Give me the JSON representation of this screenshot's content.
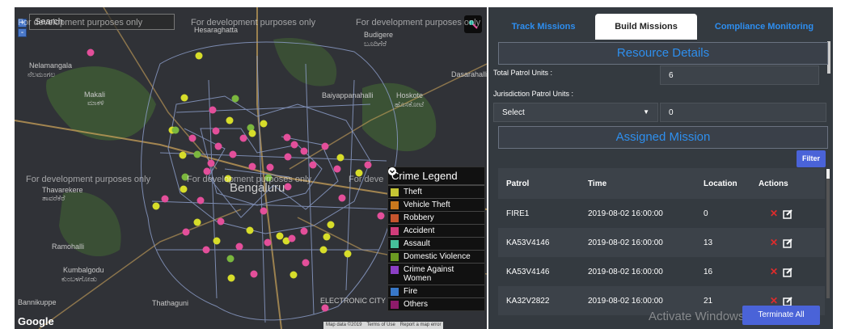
{
  "map": {
    "search_placeholder": "Search",
    "zoom_in": "+",
    "zoom_out": "-",
    "watermarks": [
      "For development purposes only",
      "For development purposes only",
      "For development purposes only",
      "For development purposes only",
      "For development purposes only",
      "For deve"
    ],
    "places": [
      "Nelamangala",
      "ನೆಲಮಂಗಲ",
      "Makali",
      "ಮಾಕಳಿ",
      "Hesaraghatta",
      "Budigere",
      "ಬೂದಿಗೆರೆ",
      "Dasarahalli",
      "Baiyappanahalli",
      "Hoskote",
      "ಹೊಸಕೋಟೆ",
      "Thavarekere",
      "ತಾವರೆಕೆರೆ",
      "Ramohalli",
      "Kumbalgodu",
      "ಕುಂಬಳಗೋಡು",
      "Bannikuppe",
      "Thathaguni",
      "ELECTRONIC CITY",
      "Bengaluru"
    ],
    "google_logo": "Google",
    "attribution": [
      "Map data ©2019",
      "Terms of Use",
      "Report a map error"
    ],
    "pin_colors": {
      "yellow": "#d7dd2a",
      "pink": "#e34f9a",
      "green": "#7bb73e"
    }
  },
  "legend": {
    "title": "Crime Legend",
    "items": [
      {
        "label": "Theft",
        "color": "#c5c534"
      },
      {
        "label": "Vehicle Theft",
        "color": "#c9781d"
      },
      {
        "label": "Robbery",
        "color": "#c5542d"
      },
      {
        "label": "Accident",
        "color": "#d13c7a"
      },
      {
        "label": "Assault",
        "color": "#45bf9a"
      },
      {
        "label": "Domestic Violence",
        "color": "#6b9a22"
      },
      {
        "label": "Crime Against Women",
        "color": "#8b3fc4"
      },
      {
        "label": "Fire",
        "color": "#3878c8"
      },
      {
        "label": "Others",
        "color": "#8e1b6b"
      }
    ]
  },
  "panel": {
    "tabs": [
      "Track Missions",
      "Build Missions",
      "Compliance Monitoring"
    ],
    "active_tab": "Build Missions",
    "resource_title": "Resource Details",
    "total_units_label": "Total Patrol Units :",
    "total_units_value": "6",
    "juris_label": "Jurisdiction Patrol Units :",
    "select_value": "Select",
    "juris_value": "0",
    "assigned_title": "Assigned Mission",
    "filter_label": "Filter",
    "columns": [
      "Patrol",
      "Time",
      "Location",
      "Actions"
    ],
    "rows": [
      {
        "patrol": "FIRE1",
        "time": "2019-08-02 16:00:00",
        "location": "0"
      },
      {
        "patrol": "KA53V4146",
        "time": "2019-08-02 16:00:00",
        "location": "13"
      },
      {
        "patrol": "KA53V4146",
        "time": "2019-08-02 16:00:00",
        "location": "16"
      },
      {
        "patrol": "KA32V2822",
        "time": "2019-08-02 16:00:00",
        "location": "21"
      }
    ],
    "terminate_label": "Terminate All",
    "activate_text": "Activate Windows",
    "colors": {
      "accent": "#2e8fee",
      "button": "#4a63d8",
      "delete": "#e02b2b"
    }
  }
}
